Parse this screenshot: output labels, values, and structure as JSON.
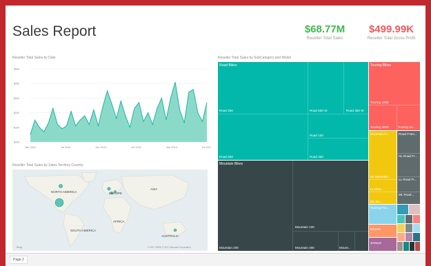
{
  "report": {
    "title": "Sales Report",
    "kpis": [
      {
        "value": "$68.77M",
        "label": "Reseller Total Sales",
        "color": "#3fb94a"
      },
      {
        "value": "$499.99K",
        "label": "Reseller Total Gross Profit",
        "color": "#f05a5a"
      }
    ],
    "captions": {
      "line": "Reseller Total Sales by Date",
      "map": "Reseller Total Sales by Sales Territory Country",
      "treemap": "Reseller Total Sales by SubCategory and Model"
    },
    "footer": {
      "page_tab": "Page 2"
    }
  },
  "chart_data": {
    "type": "area",
    "title": "Reseller Total Sales by Date",
    "x": [
      "Jan 2011",
      "Jul 2011",
      "Jan 2012",
      "Jul 2012",
      "Jan 2013",
      "Jul 2013"
    ],
    "ylabels": [
      "$0M",
      "$1M",
      "$2M",
      "$3M",
      "$4M",
      "$5M"
    ],
    "ylim": [
      0,
      5
    ],
    "values": [
      0.5,
      1.5,
      1.0,
      0.7,
      1.3,
      2.3,
      1.2,
      0.9,
      1.1,
      2.1,
      1.1,
      1.5,
      1.8,
      1.2,
      2.2,
      1.1,
      2.4,
      3.5,
      2.6,
      1.6,
      2.8,
      1.8,
      1.0,
      2.3,
      2.7,
      1.4,
      2.0,
      1.2,
      2.3,
      3.0,
      1.5,
      3.0,
      4.1,
      2.2,
      1.3,
      3.4,
      3.6,
      2.0,
      1.4,
      2.7
    ],
    "color": "#7ed6c3",
    "line_color": "#1fb4a0"
  },
  "map": {
    "labels": [
      "NORTH AMERICA",
      "EUROPE",
      "ASIA",
      "AFRICA",
      "SOUTH AMERICA",
      "AUSTRALIA"
    ],
    "brand": "Bing",
    "copyright": "© 2017 HERE © 2017 Microsoft Corporation"
  },
  "treemap": {
    "groups": [
      {
        "name": "Road Bikes",
        "color": "#01b8aa"
      },
      {
        "name": "Mountain Bikes",
        "color": "#374649"
      },
      {
        "name": "Touring Bikes",
        "color": "#fd625e"
      }
    ],
    "labels": {
      "road250": "Road 250",
      "road550w": "Road 550 W",
      "road350w": "Road 350 W",
      "road650": "Road 650",
      "road150": "Road 150",
      "road450": "Road 450",
      "mtn100": "Mountain 100",
      "mtn200": "Mountain 200",
      "mtn300": "Mountain 300",
      "mtn_other": "Mount...",
      "touring1000": "Touring 1000",
      "touring3000": "Touring 3000",
      "touring2000": "Touring 20...",
      "mtn_frames": "Mountain Fr...",
      "road_frames": "Road Fram...",
      "hl_mountain": "HL Mountain...",
      "ll_mountain": "LL Mou...",
      "ml_mou": "ML Mo...",
      "hl_road": "HL Road Fr...",
      "ll_road": "LL Road Fr...",
      "ml_road": "ML Road...",
      "touring_frames": "Touring Fra...",
      "wheels": "Wheels",
      "jerseys": "Jerseys"
    }
  }
}
